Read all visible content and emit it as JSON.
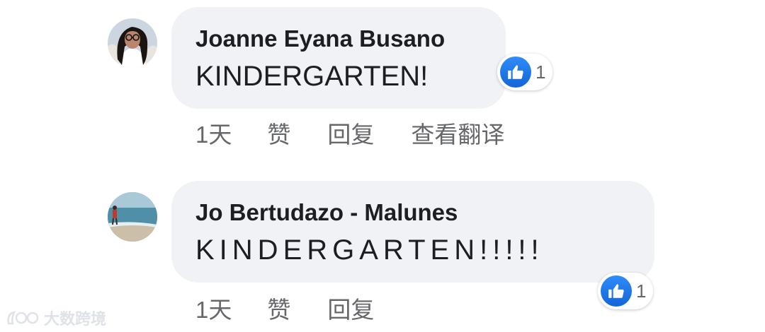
{
  "comments": [
    {
      "author": "Joanne Eyana Busano",
      "text": "KINDERGARTEN!",
      "time": "1天",
      "like_label": "赞",
      "reply_label": "回复",
      "translate_label": "查看翻译",
      "reaction_icon": "like-thumbs-up-icon",
      "reaction_count": "1"
    },
    {
      "author": "Jo Bertudazo - Malunes",
      "text": "KINDERGARTEN!!!!!",
      "time": "1天",
      "like_label": "赞",
      "reply_label": "回复",
      "reaction_icon": "like-thumbs-up-icon",
      "reaction_count": "1"
    }
  ],
  "watermark": {
    "text": "大数跨境"
  },
  "colors": {
    "bubble": "#f0f2f5",
    "like_blue": "#1877f2",
    "secondary_text": "#65676b",
    "primary_text": "#1c1e21"
  }
}
